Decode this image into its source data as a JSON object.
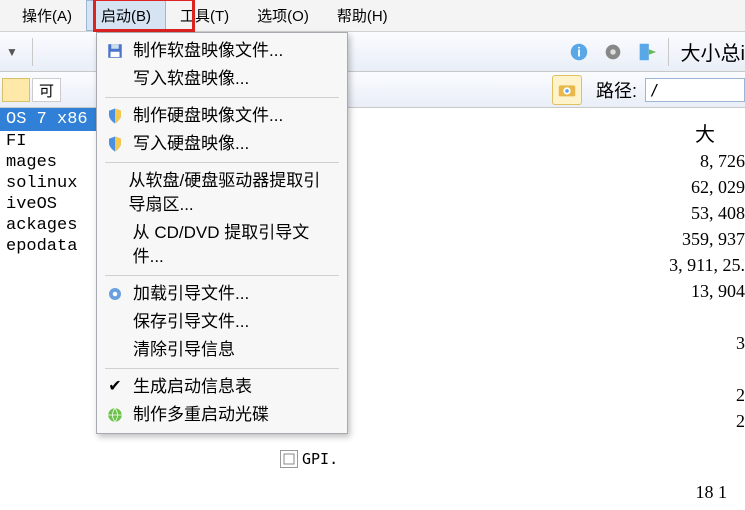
{
  "menubar": {
    "items": [
      "操作(A)",
      "启动(B)",
      "工具(T)",
      "选项(O)",
      "帮助(H)"
    ],
    "active_index": 1
  },
  "toolbar": {
    "right_label": "大小总i"
  },
  "pathbar": {
    "label": "路径:",
    "value": "/",
    "left_button": "可"
  },
  "dropdown": {
    "groups": [
      [
        {
          "icon": "floppy",
          "label": "制作软盘映像文件..."
        },
        {
          "icon": "none",
          "label": "写入软盘映像..."
        }
      ],
      [
        {
          "icon": "shield",
          "label": "制作硬盘映像文件..."
        },
        {
          "icon": "shield",
          "label": "写入硬盘映像...",
          "highlight": true
        }
      ],
      [
        {
          "icon": "none",
          "label": "从软盘/硬盘驱动器提取引导扇区..."
        },
        {
          "icon": "none",
          "label": "从 CD/DVD 提取引导文件..."
        }
      ],
      [
        {
          "icon": "gear",
          "label": "加载引导文件..."
        },
        {
          "icon": "none",
          "label": "保存引导文件..."
        },
        {
          "icon": "none",
          "label": "清除引导信息"
        }
      ],
      [
        {
          "icon": "check",
          "label": "生成启动信息表"
        },
        {
          "icon": "globe",
          "label": "制作多重启动光碟"
        }
      ]
    ]
  },
  "left_tree": {
    "tab": "OS 7 x86",
    "items": [
      "FI",
      "mages",
      "solinux",
      "iveOS",
      "ackages",
      "epodata"
    ]
  },
  "right_column": {
    "header": "大",
    "values": [
      "8, 726",
      "62, 029",
      "53, 408",
      "359, 937",
      "3, 911, 25.",
      "13, 904",
      "",
      "3",
      "",
      "2",
      "2"
    ]
  },
  "bottom": {
    "file": "GPI.",
    "num": "18 1"
  }
}
